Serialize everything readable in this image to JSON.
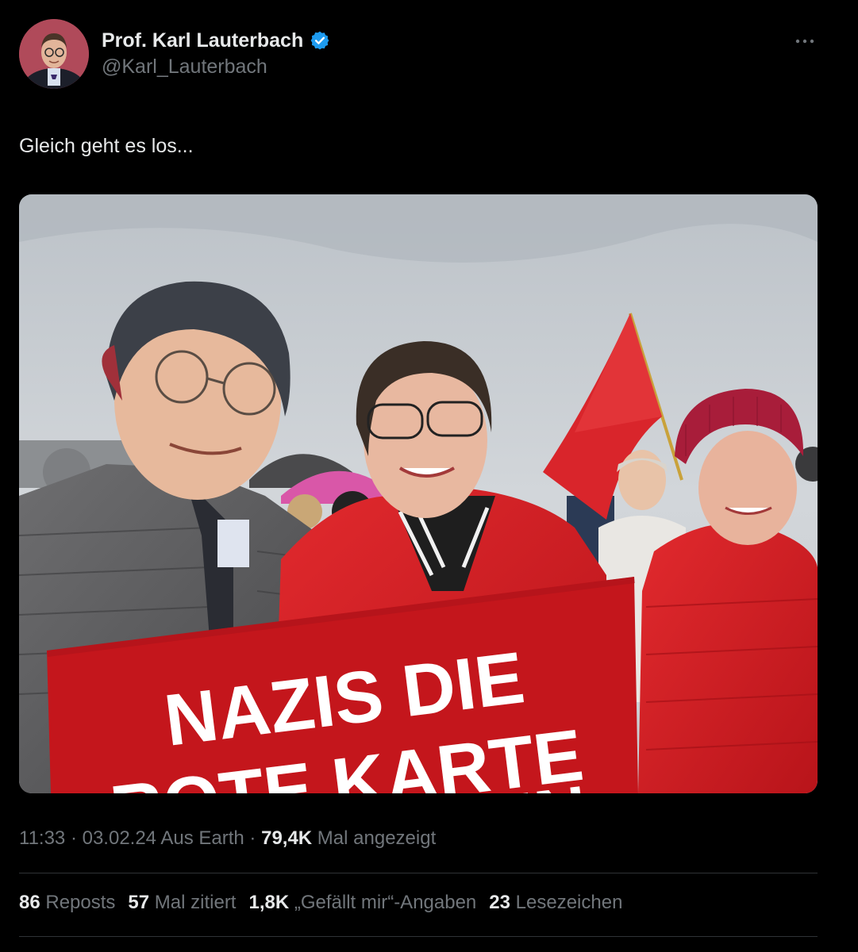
{
  "author": {
    "display_name": "Prof. Karl Lauterbach",
    "handle": "@Karl_Lauterbach",
    "verified_icon": "verified-badge-icon",
    "avatar_icon": "profile-photo"
  },
  "tweet": {
    "text": "Gleich geht es los...",
    "media": {
      "sign_line1": "NAZIS DIE",
      "sign_line2": "ROTE KARTE",
      "sign_line3": "ZEIGEN"
    }
  },
  "meta": {
    "time": "11:33",
    "separator1": " · ",
    "date": "03.02.24",
    "source": " Aus Earth",
    "separator2": " · ",
    "views_count": "79,4K",
    "views_label": " Mal angezeigt"
  },
  "stats": {
    "reposts_count": "86",
    "reposts_label": "Reposts",
    "quotes_count": "57",
    "quotes_label": "Mal zitiert",
    "likes_count": "1,8K",
    "likes_label": "„Gefällt mir“-Angaben",
    "bookmarks_count": "23",
    "bookmarks_label": "Lesezeichen"
  },
  "colors": {
    "background": "#000000",
    "text_primary": "#e7e9ea",
    "text_secondary": "#71767b",
    "verified_blue": "#1d9bf0",
    "sign_red": "#c4161c",
    "divider": "#2f3336"
  }
}
